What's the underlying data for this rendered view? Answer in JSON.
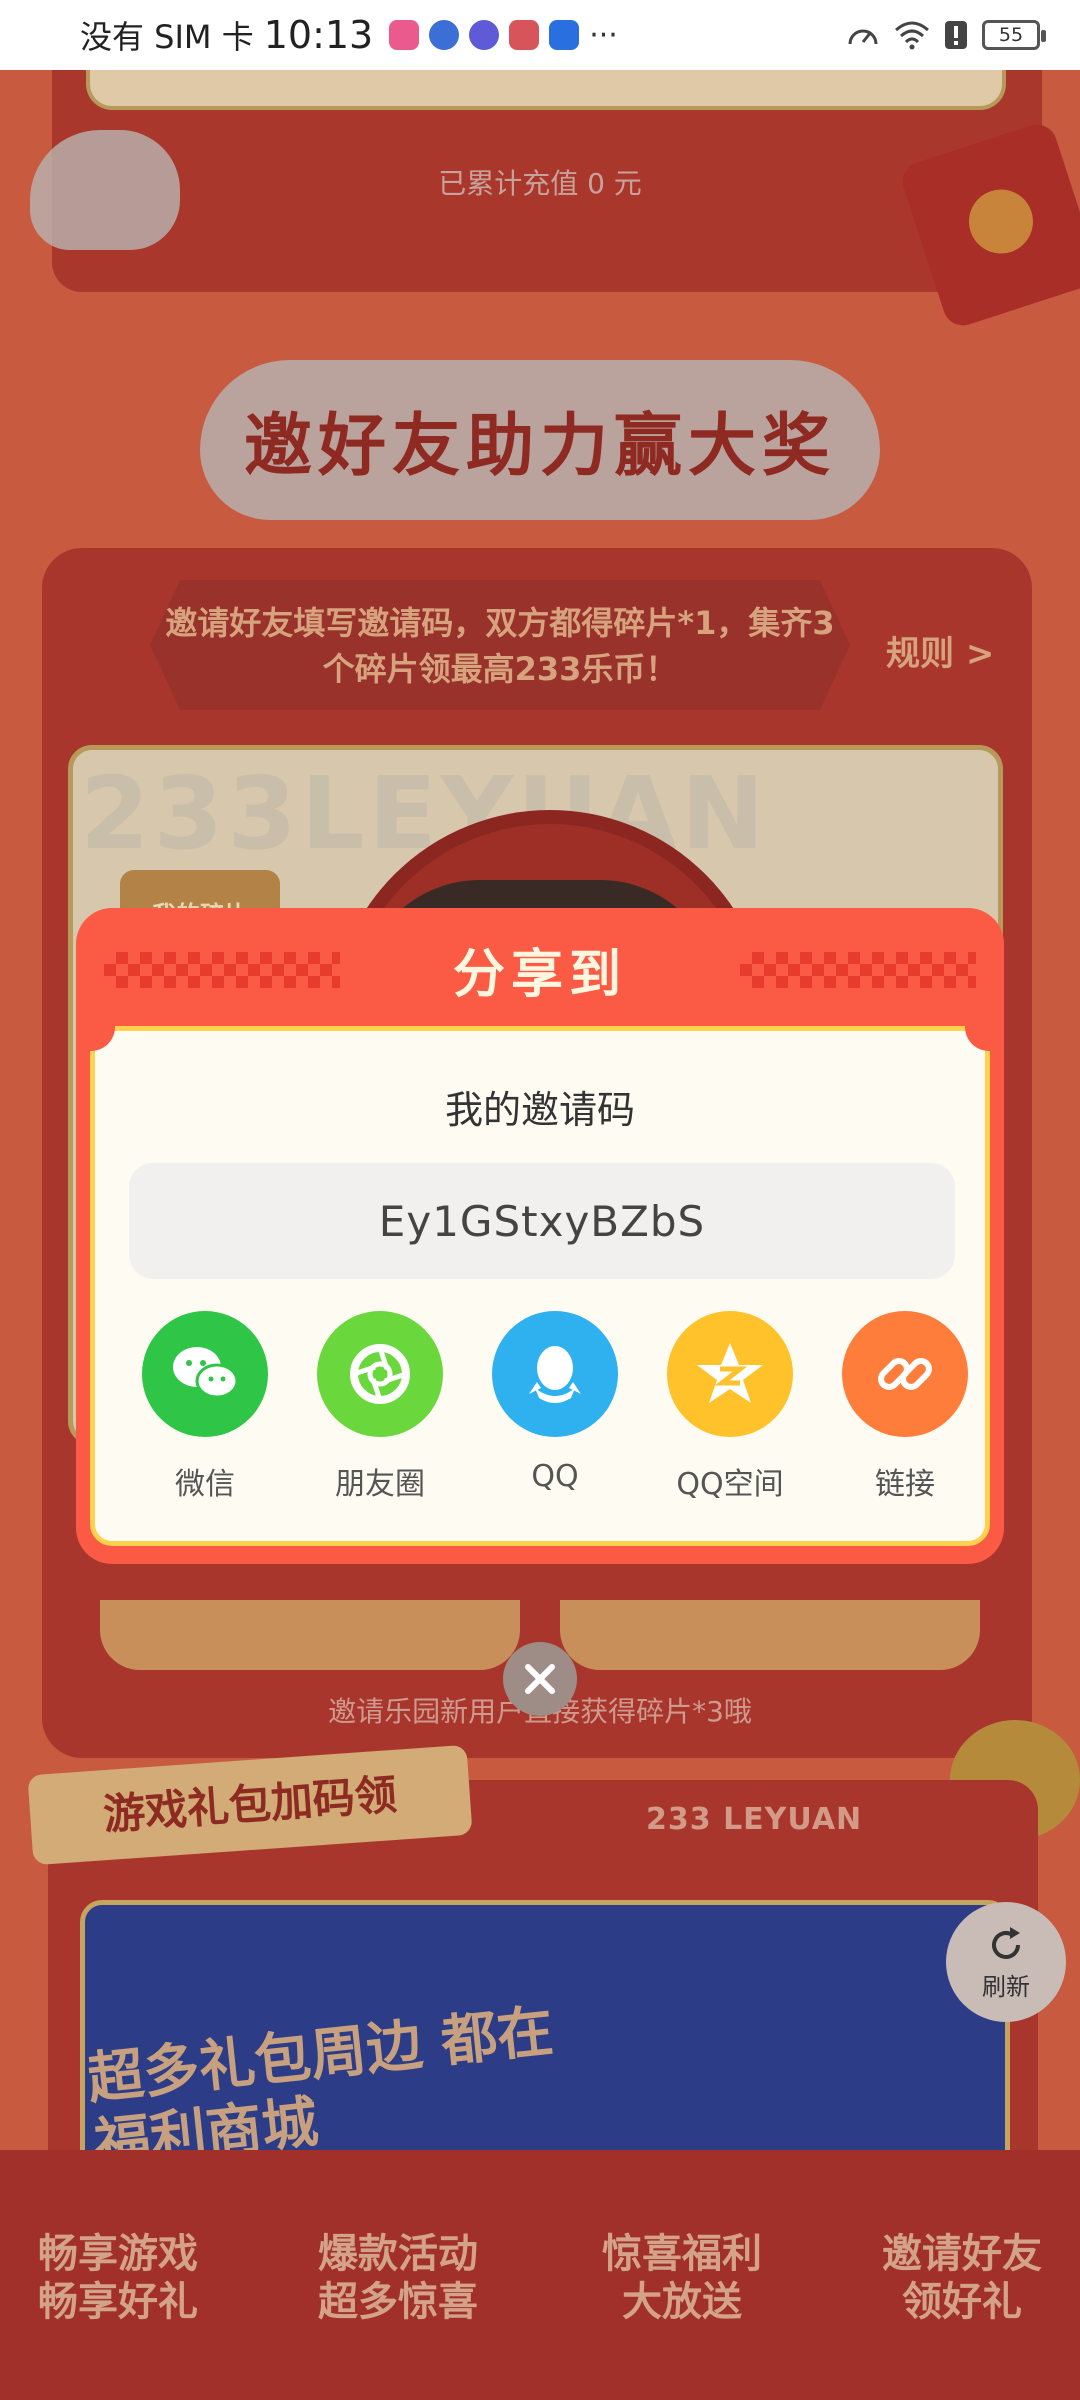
{
  "status_bar": {
    "carrier": "没有 SIM 卡",
    "time": "10:13",
    "more": "···",
    "battery": "55",
    "app_icon_colors": [
      "#ea5a8c",
      "#3b6fd6",
      "#5f5ad6",
      "#d6545a",
      "#2a6fe0"
    ]
  },
  "background": {
    "recharge_total": "已累计充值 0 元",
    "invite_title": "邀好友助力赢大奖",
    "rule_text": "邀请好友填写邀请码，双方都得碎片*1，集齐3个碎片领最高233乐币！",
    "rules_link": "规则 >",
    "watermark_letters": "233LEYUAN",
    "my_shards": "我的碎片",
    "helper_text": "邀请乐园新用户直接获得碎片*3哦",
    "gift_tag": "游戏礼包加码领",
    "leyuan_text": "233 LEYUAN",
    "gift_banner_text": "超多礼包周边 都在福利商城",
    "refresh": "刷新",
    "bottom_items": [
      "畅享游戏 畅享好礼",
      "爆款活动 超多惊喜",
      "惊喜福利 大放送",
      "邀请好友 领好礼"
    ]
  },
  "modal": {
    "title": "分享到",
    "code_label": "我的邀请码",
    "invite_code": "Ey1GStxyBZbS",
    "share_targets": [
      {
        "label": "微信",
        "color": "#2fc547",
        "icon": "wechat-icon"
      },
      {
        "label": "朋友圈",
        "color": "#6ad73c",
        "icon": "moments-icon"
      },
      {
        "label": "QQ",
        "color": "#2fb0ef",
        "icon": "qq-icon"
      },
      {
        "label": "QQ空间",
        "color": "#ffc22a",
        "icon": "qzone-icon"
      },
      {
        "label": "链接",
        "color": "#ff7d3a",
        "icon": "link-icon"
      }
    ]
  }
}
